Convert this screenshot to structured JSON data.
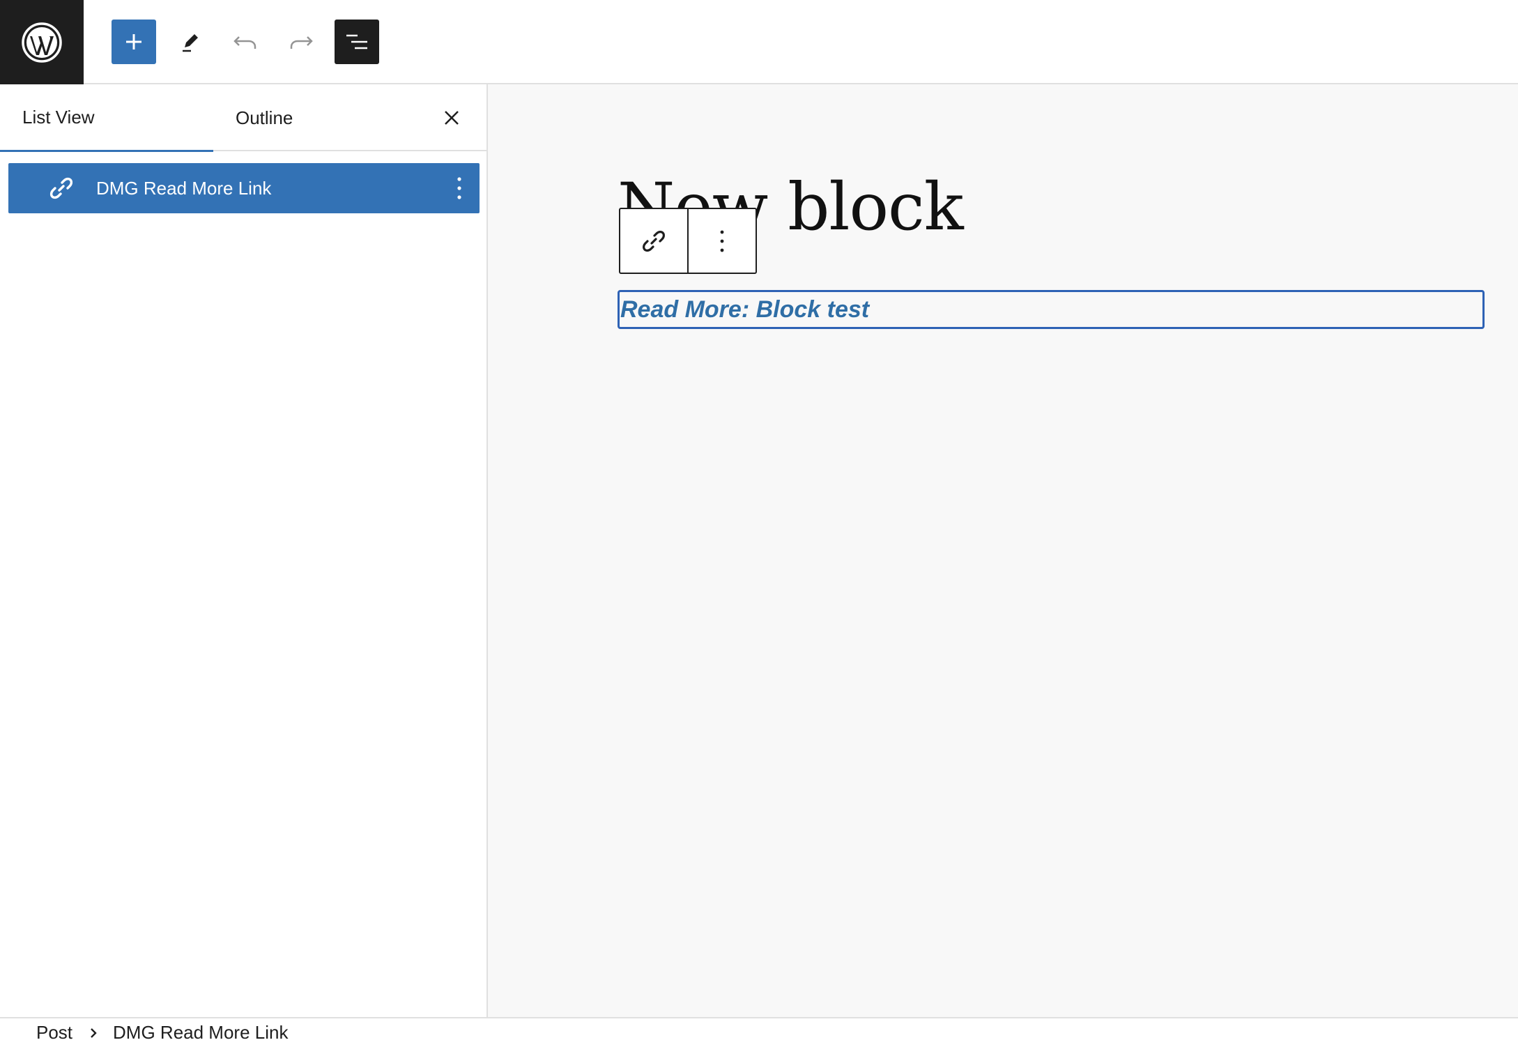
{
  "colors": {
    "accent": "#3372b5",
    "dark": "#1e1e1e",
    "canvas_bg": "#f8f8f8",
    "selection_border": "#2e62b5",
    "link_text": "#2f6ea6"
  },
  "toolbar": {
    "logo_icon": "wordpress-logo-icon",
    "add_icon": "plus-icon",
    "edit_icon": "pencil-icon",
    "undo_icon": "undo-icon",
    "redo_icon": "redo-icon",
    "list_view_icon": "list-view-icon"
  },
  "sidebar": {
    "tabs": [
      {
        "label": "List View",
        "active": true
      },
      {
        "label": "Outline",
        "active": false
      }
    ],
    "close_icon": "close-icon",
    "items": [
      {
        "label": "DMG Read More Link",
        "icon": "link-icon",
        "selected": true,
        "options_icon": "more-vertical-icon"
      }
    ]
  },
  "canvas": {
    "post_title": "New block",
    "block_toolbar": {
      "block_type_icon": "link-icon",
      "options_icon": "more-vertical-icon"
    },
    "read_more": {
      "text": "Read More: Block test"
    }
  },
  "breadcrumb": {
    "items": [
      "Post",
      "DMG Read More Link"
    ],
    "separator_icon": "chevron-right-icon"
  }
}
